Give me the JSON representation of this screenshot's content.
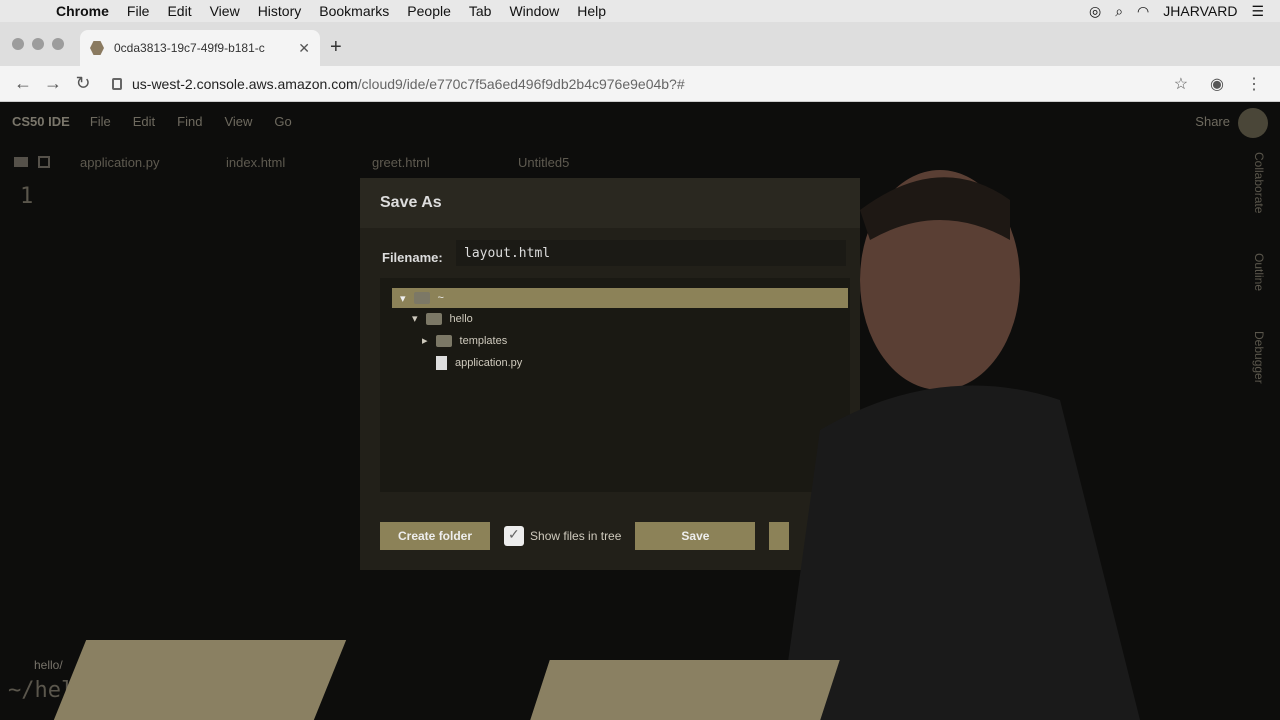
{
  "os_menu": {
    "app": "Chrome",
    "items": [
      "File",
      "Edit",
      "View",
      "History",
      "Bookmarks",
      "People",
      "Tab",
      "Window",
      "Help"
    ],
    "user": "JHARVARD",
    "icons": [
      "apple-icon",
      "creative-cloud-icon",
      "search-icon",
      "wifi-icon",
      "list-icon"
    ]
  },
  "browser": {
    "tab_title": "0cda3813-19c7-49f9-b181-c",
    "url_host": "us-west-2.console.aws.amazon.com",
    "url_path": "/cloud9/ide/e770c7f5a6ed496f9db2b4c976e9e04b?#"
  },
  "ide": {
    "brand": "CS50 IDE",
    "menu": [
      "File",
      "Edit",
      "Find",
      "View",
      "Go"
    ],
    "share": "Share",
    "file_tabs": [
      "application.py",
      "index.html",
      "greet.html",
      "Untitled5"
    ],
    "line_number": "1",
    "right_rail": [
      "Collaborate",
      "Outline",
      "Debugger"
    ],
    "terminal_path": "hello/",
    "terminal_prompt": "~/hell"
  },
  "dialog": {
    "title": "Save As",
    "filename_label": "Filename:",
    "filename_value": "layout.html",
    "tree": {
      "root": "~",
      "folder": "hello",
      "subfolder": "templates",
      "file": "application.py"
    },
    "buttons": {
      "create_folder": "Create folder",
      "show_files": "Show files in tree",
      "save": "Save",
      "cancel": ""
    }
  }
}
